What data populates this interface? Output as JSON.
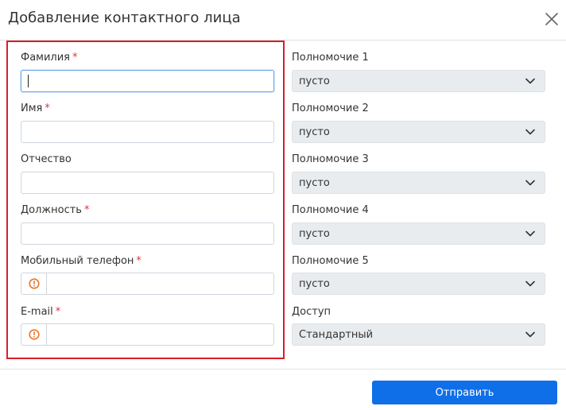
{
  "dialog": {
    "title": "Добавление контактного лица",
    "submit_label": "Отправить"
  },
  "left_fields": {
    "surname": {
      "label": "Фамилия",
      "value": ""
    },
    "name": {
      "label": "Имя",
      "value": ""
    },
    "patronymic": {
      "label": "Отчество",
      "value": ""
    },
    "position": {
      "label": "Должность",
      "value": ""
    },
    "mobile": {
      "label": "Мобильный телефон",
      "value": "",
      "icon": "warning-circle-icon"
    },
    "email": {
      "label": "E-mail",
      "value": "",
      "icon": "warning-circle-icon"
    }
  },
  "required_mark": "*",
  "right_fields": {
    "p1": {
      "label": "Полномочие 1",
      "value": "пусто"
    },
    "p2": {
      "label": "Полномочие 2",
      "value": "пусто"
    },
    "p3": {
      "label": "Полномочие 3",
      "value": "пусто"
    },
    "p4": {
      "label": "Полномочие 4",
      "value": "пусто"
    },
    "p5": {
      "label": "Полномочие 5",
      "value": "пусто"
    },
    "access": {
      "label": "Доступ",
      "value": "Стандартный"
    }
  },
  "colors": {
    "accent": "#0f6fe8",
    "highlight": "#d81e2a",
    "required": "#e0313f",
    "warning": "#e8772e"
  }
}
